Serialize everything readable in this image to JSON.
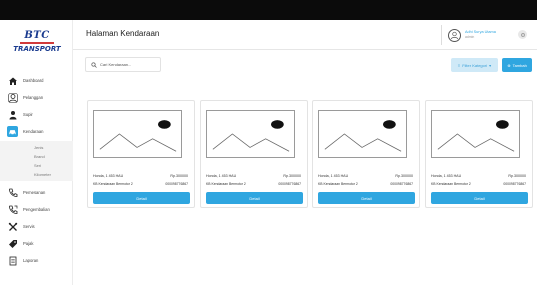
{
  "logo": {
    "top": "BTC",
    "bottom": "TRANSPORT"
  },
  "header": {
    "title": "Halaman Kendaraan"
  },
  "user": {
    "name": "Adhi Surya Utama",
    "role": "admin"
  },
  "sidebar": {
    "items": [
      {
        "label": "Dashboard",
        "icon": "home-icon"
      },
      {
        "label": "Pelanggan",
        "icon": "customer-icon"
      },
      {
        "label": "Supir",
        "icon": "driver-icon"
      },
      {
        "label": "Kendaraan",
        "icon": "vehicle-icon",
        "active": true
      },
      {
        "label": "Pemesanan",
        "icon": "phone-icon"
      },
      {
        "label": "Pengembalian",
        "icon": "return-icon"
      },
      {
        "label": "Servis",
        "icon": "wrench-icon"
      },
      {
        "label": "Pajak",
        "icon": "tag-icon"
      },
      {
        "label": "Laporan",
        "icon": "report-icon"
      }
    ],
    "submenu": [
      "Jenis",
      "Brand",
      "Seri",
      "Kilometer"
    ]
  },
  "search": {
    "placeholder": "Cari Kendaraan..."
  },
  "buttons": {
    "filter": "Filter Kategori",
    "add": "Tambah"
  },
  "accent": "#2fa6e0",
  "cards": [
    {
      "name": "Honda, 1 453 HAU",
      "price": "Rp.300000",
      "type": "KB Kendaraan Bermotor 2",
      "code": "000098776867",
      "button": "Detail"
    },
    {
      "name": "Honda, 1 453 HAU",
      "price": "Rp.300000",
      "type": "KB Kendaraan Bermotor 2",
      "code": "000098776867",
      "button": "Detail"
    },
    {
      "name": "Honda, 1 453 HAU",
      "price": "Rp.300000",
      "type": "KB Kendaraan Bermotor 2",
      "code": "000098776867",
      "button": "Detail"
    },
    {
      "name": "Honda, 1 453 HAU",
      "price": "Rp.300000",
      "type": "KB Kendaraan Bermotor 2",
      "code": "000098776867",
      "button": "Detail"
    }
  ]
}
